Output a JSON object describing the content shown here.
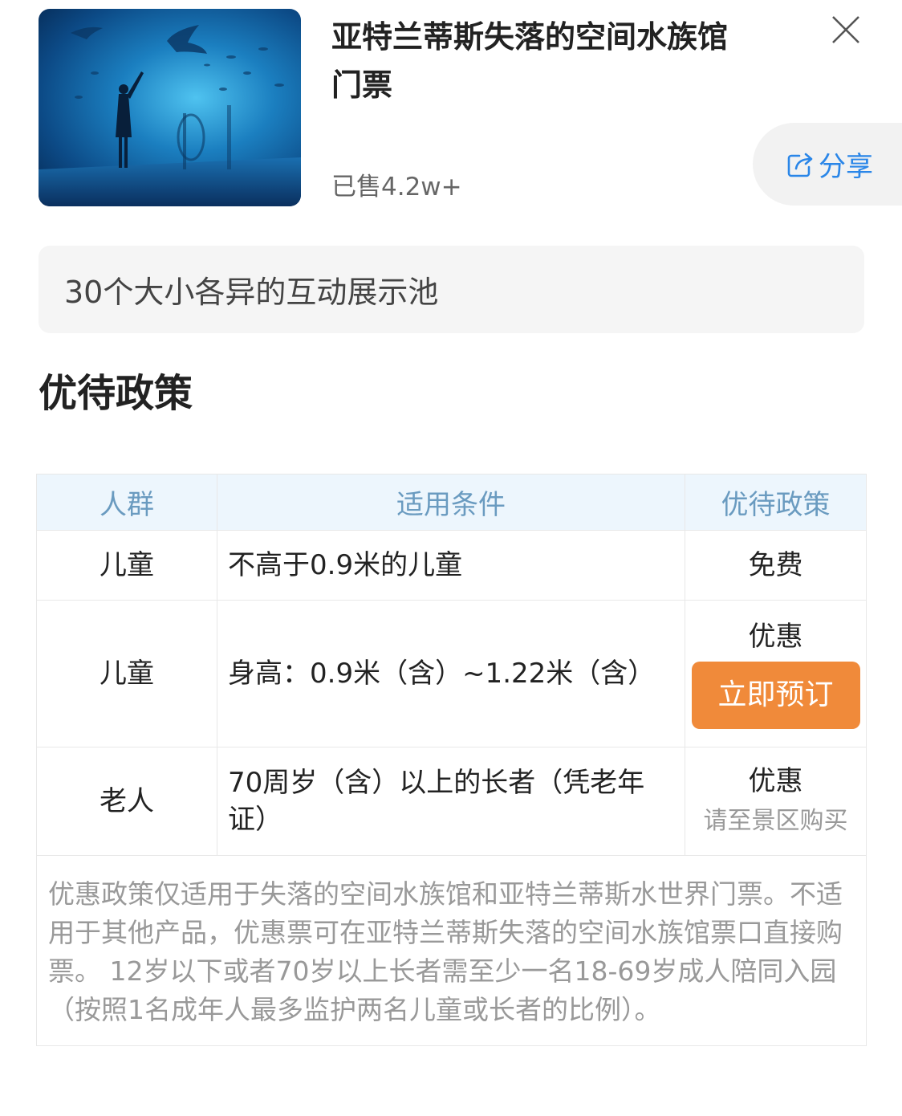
{
  "header": {
    "title": "亚特兰蒂斯失落的空间水族馆门票",
    "sold_text": "已售4.2w+",
    "share_label": "分享",
    "close_icon": "close-icon",
    "share_icon": "share-icon"
  },
  "highlight": {
    "text": "30个大小各异的互动展示池"
  },
  "policy": {
    "section_title": "优待政策",
    "columns": [
      "人群",
      "适用条件",
      "优待政策"
    ],
    "rows": [
      {
        "group": "儿童",
        "condition": "不高于0.9米的儿童",
        "policy": "免费"
      },
      {
        "group": "儿童",
        "condition": "身高：0.9米（含）~1.22米（含）",
        "policy": "优惠",
        "button_label": "立即预订"
      },
      {
        "group": "老人",
        "condition": "70周岁（含）以上的长者（凭老年证）",
        "policy": "优惠",
        "note": "请至景区购买"
      }
    ],
    "footnote": "优惠政策仅适用于失落的空间水族馆和亚特兰蒂斯水世界门票。不适用于其他产品，优惠票可在亚特兰蒂斯失落的空间水族馆票口直接购票。 12岁以下或者70岁以上长者需至少一名18-69岁成人陪同入园（按照1名成年人最多监护两名儿童或长者的比例）。"
  },
  "colors": {
    "accent_blue": "#2a86e8",
    "book_orange": "#f08a3a",
    "header_bg": "#edf6fd",
    "header_text": "#6a9bc0"
  }
}
